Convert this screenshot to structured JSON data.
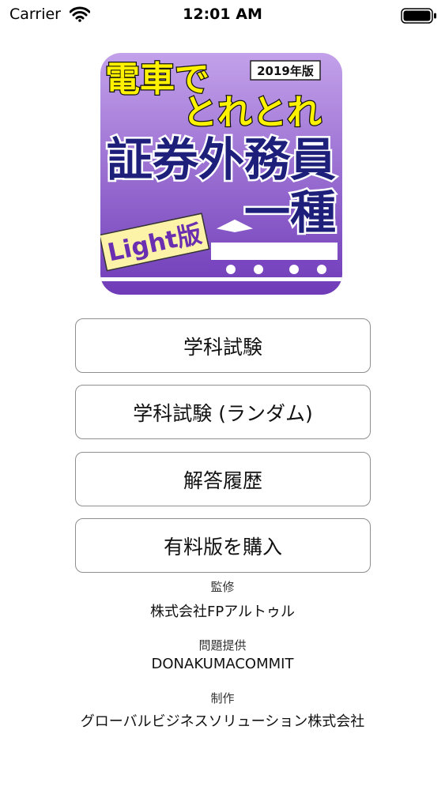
{
  "status_bar": {
    "carrier": "Carrier",
    "time": "12:01 AM",
    "wifi_icon": "wifi-icon",
    "battery_icon": "battery-icon"
  },
  "logo": {
    "line1": "電車で",
    "line2": "とれとれ",
    "edition": "2019年版",
    "title": "証券外務員",
    "subtitle": "一種",
    "badge": "Light版",
    "colors": {
      "background_top": "#b58be0",
      "background_bottom": "#7a45c0",
      "accent_yellow": "#fff200",
      "title_navy": "#1d1f7a",
      "badge_bg": "#fdf3a8"
    }
  },
  "menu": {
    "exam": "学科試験",
    "exam_random": "学科試験 (ランダム)",
    "history": "解答履歴",
    "purchase": "有料版を購入"
  },
  "credits": [
    {
      "title": "監修",
      "value": "株式会社FPアルトゥル"
    },
    {
      "title": "問題提供",
      "value": "DONAKUMACOMMIT"
    },
    {
      "title": "制作",
      "value": "グローバルビジネスソリューション株式会社"
    }
  ]
}
